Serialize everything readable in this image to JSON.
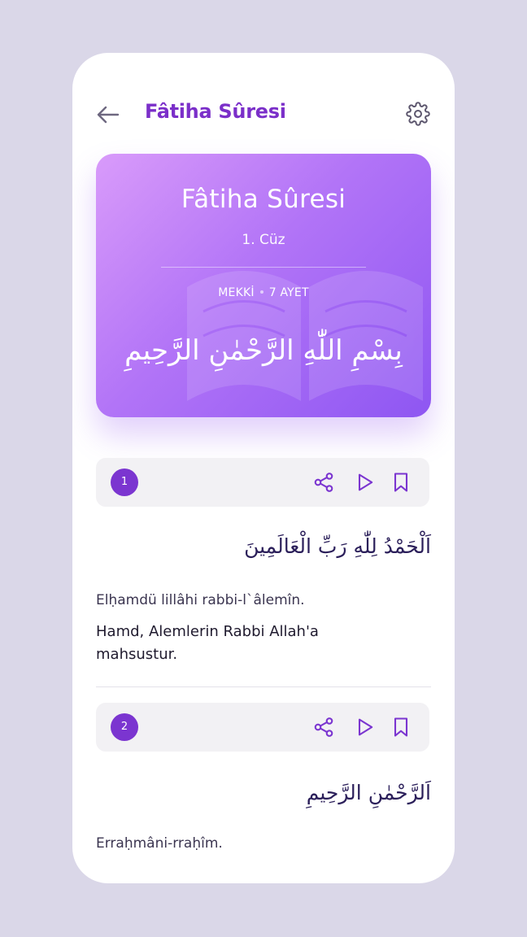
{
  "header": {
    "title": "Fâtiha Sûresi",
    "back_icon": "arrow-left-icon",
    "settings_icon": "gear-icon"
  },
  "hero": {
    "title": "Fâtiha Sûresi",
    "juz": "1. Cüz",
    "origin": "MEKKİ",
    "verse_count": "7 AYET",
    "basmala": "بِسْمِ اللّٰهِ الرَّحْمٰنِ الرَّحِيمِ"
  },
  "verses": [
    {
      "number": "1",
      "arabic": "اَلْحَمْدُ لِلّٰهِ رَبِّ الْعَالَمِينَ",
      "transliteration": "Elḥamdü lillâhi rabbi-l`âlemîn.",
      "translation": "Hamd, Alemlerin Rabbi Allah'a mahsustur."
    },
    {
      "number": "2",
      "arabic": "اَلرَّحْمٰنِ الرَّحِيمِ",
      "transliteration": "Erraḥmâni-rraḥîm.",
      "translation": ""
    }
  ],
  "actions": {
    "share_icon": "share-icon",
    "play_icon": "play-icon",
    "bookmark_icon": "bookmark-icon"
  },
  "colors": {
    "background": "#dad7e8",
    "accent": "#7b2fc9",
    "hero_gradient_start": "#d99bfa",
    "hero_gradient_end": "#8e56f2",
    "verse_bar": "#f2f1f4"
  }
}
